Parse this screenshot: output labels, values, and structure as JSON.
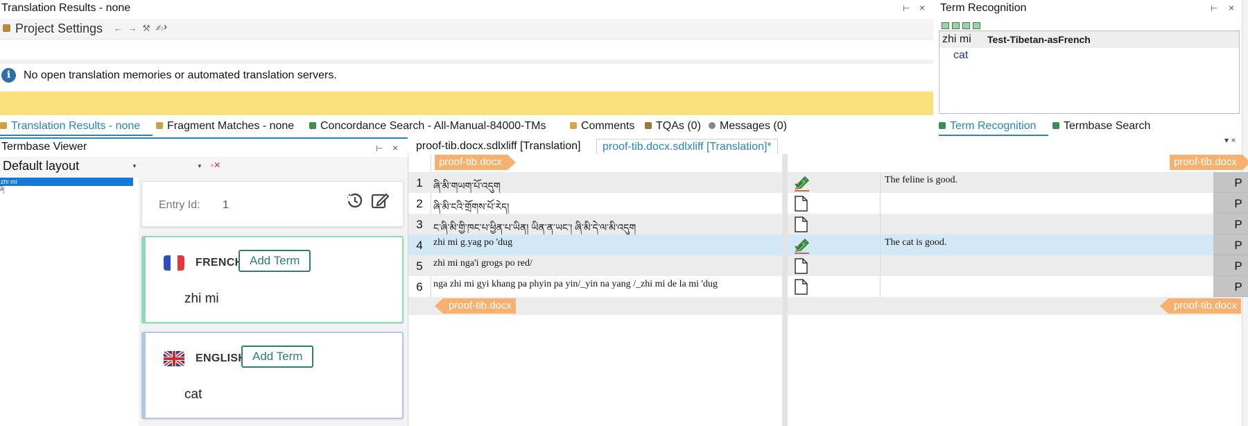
{
  "translation_results": {
    "title": "Translation Results - none",
    "pin_glyph": "⊢",
    "close_glyph": "×",
    "project_settings_label": "Project Settings",
    "info_message": "No open translation memories or automated translation servers.",
    "yellow_bar_color": "#f9e07a"
  },
  "bottom_tabs": [
    {
      "label": "Translation Results - none",
      "active": true,
      "icon_color": "#c9a24a"
    },
    {
      "label": "Fragment Matches - none",
      "active": false,
      "icon_color": "#c9a24a"
    },
    {
      "label": "Concordance Search - All-Manual-84000-TMs",
      "active": false,
      "icon_color": "#3b8f56"
    },
    {
      "label": "Comments",
      "active": false,
      "icon_color": "#d4a84a"
    },
    {
      "label": "TQAs (0)",
      "active": false,
      "icon_color": "#9a7a3a"
    },
    {
      "label": "Messages (0)",
      "active": false,
      "icon_color": "#888888"
    }
  ],
  "term_recognition": {
    "title": "Term Recognition",
    "source_term": "zhi mi",
    "termbase_name": "Test-Tibetan-asFrench",
    "target_term": "cat",
    "tabs": [
      {
        "label": "Term Recognition",
        "active": true
      },
      {
        "label": "Termbase Search",
        "active": false
      }
    ]
  },
  "termbase_viewer": {
    "title": "Termbase Viewer",
    "layout": "Default layout",
    "list_items": [
      "zhi mi",
      "ཞི་"
    ],
    "entry_label": "Entry Id:",
    "entry_id": "1",
    "languages": [
      {
        "name": "FRENCH",
        "add_label": "Add Term",
        "term": "zhi mi",
        "accent": "#8fd8b8"
      },
      {
        "name": "ENGLISH",
        "add_label": "Add Term",
        "term": "cat",
        "accent": "#b5c4e8"
      }
    ]
  },
  "editor": {
    "tabs": [
      {
        "label": "proof-tib.docx.sdlxliff [Translation]",
        "active": false
      },
      {
        "label": "proof-tib.docx.sdlxliff [Translation]*",
        "active": true
      }
    ],
    "file_tag": "proof-tib.docx",
    "tag_color": "#f7b06e",
    "segments": [
      {
        "num": "1",
        "source": "ཞི་མི་གཡག་པོ་འདུག",
        "status": "translated",
        "target": "The feline is good.",
        "lock": "P"
      },
      {
        "num": "2",
        "source": "ཞི་མི་ངའི་གྲོགས་པོ་རེད།",
        "status": "empty",
        "target": "",
        "lock": "P"
      },
      {
        "num": "3",
        "source": "ང་ཞི་མི་གྱི་ཁང་པ་ཕྱིན་པ་ཡིན། ཡིན་ན་ཡང་། ཞི་མི་དེ་ལ་མི་འདུག",
        "status": "empty",
        "target": "",
        "lock": "P"
      },
      {
        "num": "4",
        "source": "zhi mi g.yag po 'dug",
        "status": "translated",
        "target": "The cat is good.",
        "lock": "P"
      },
      {
        "num": "5",
        "source": "zhi mi nga'i grogs po red/",
        "status": "empty",
        "target": "",
        "lock": "P"
      },
      {
        "num": "6",
        "source": "nga zhi mi gyi khang pa phyin pa yin/_yin na yang /_zhi mi de la mi 'dug",
        "status": "empty",
        "target": "",
        "lock": "P"
      }
    ]
  }
}
